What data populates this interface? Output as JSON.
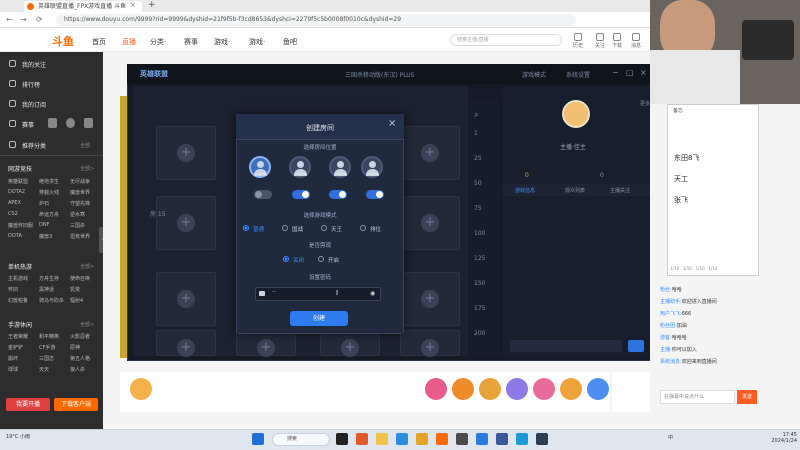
{
  "browser": {
    "tab_title": "英雄联盟直播_FPX游戏直播 斗鱼",
    "tab_close": "×",
    "new_tab": "+",
    "url": "https://www.douyu.com/9999?rid=9999&dyshid=21f9f5b-f3cd8653&dyshci=2279f5c5b0008f0010c&dyshid=29",
    "nav_back": "←",
    "nav_forward": "→",
    "nav_reload": "⟳"
  },
  "site": {
    "logo": "斗鱼",
    "nav": [
      "首页",
      "直播",
      "分类·",
      "赛事",
      "游戏·",
      "游戏·",
      "鱼吧"
    ],
    "search_placeholder": "搜索主播/直播",
    "header_icons": [
      "历史",
      "关注",
      "下载",
      "消息"
    ]
  },
  "sidebar": {
    "top_items": [
      "我的关注",
      "排行榜",
      "我的订阅",
      "赛事"
    ],
    "section1_title": "推荐分类",
    "section1_more": "全部",
    "section2_title": "网游竞技",
    "section2_more": "全部>",
    "section2_grid": [
      "英雄联盟",
      "绝地求生",
      "无尽战争",
      "DOTA2",
      "穿越火线",
      "魔兽世界",
      "APEX",
      "炉石",
      "守望先锋",
      "CS2",
      "命运方舟",
      "逆水寒",
      "魔兽怀旧服",
      "DNF",
      "三国杀",
      "DOTA",
      "魔兽3",
      "坦克世界"
    ],
    "section3_title": "单机热游",
    "section3_more": "全部>",
    "section3_grid": [
      "主机游戏",
      "方舟生存",
      "使命召唤",
      "怀旧",
      "黑神话",
      "饥荒",
      "幻兽帕鲁",
      "骑马与砍杀",
      "辐射4"
    ],
    "section4_title": "手游休闲",
    "section4_more": "全部>",
    "section4_grid": [
      "王者荣耀",
      "和平精英",
      "火影忍者",
      "金铲铲",
      "CF手游",
      "原神",
      "崩坏",
      "三国志",
      "第五人格",
      "球球",
      "天天",
      "狼人杀"
    ],
    "btn_live": "我要开播",
    "btn_download": "下载客户端"
  },
  "client": {
    "app_name": "英雄联盟",
    "room_title": "三国杀移动版(东汉) PLUS",
    "mode_btn": "游戏模式",
    "settings_btn": "系统设置",
    "min": "−",
    "max": "□",
    "close": "×",
    "slot_room_label": "房 15",
    "numbers": [
      "1",
      "25",
      "50",
      "75",
      "100",
      "125",
      "150",
      "175",
      "200"
    ],
    "right_name": "主播·佳主",
    "right_tabs": [
      "游戏信息",
      "观众列表",
      "主播关注"
    ],
    "coin": "0",
    "chip": "0",
    "right_more": "更多>",
    "plus": "+"
  },
  "dialog": {
    "title": "创建房间",
    "close": "×",
    "seat_section": "选择房间位置",
    "seats": [
      "PLAYER",
      "PLAYER",
      "PLAYER",
      "PLAYER"
    ],
    "seat_toggles": [
      false,
      true,
      true,
      true
    ],
    "mode_section": "选择游戏模式",
    "modes": [
      "普通",
      "国战",
      "天王",
      "排位"
    ],
    "mode_selected": 0,
    "audience_section": "是否旁观",
    "audience_options": [
      "关闭",
      "开启"
    ],
    "audience_selected": 0,
    "password_section": "设置密码",
    "password_value": "··",
    "create_btn": "创建"
  },
  "note": {
    "title": "备忘",
    "lines": [
      "东田8飞",
      "天工",
      "张飞"
    ],
    "footer": [
      "1/10",
      "1/10",
      "1/10",
      "1/10"
    ]
  },
  "danmu": [
    {
      "user": "粉丝:",
      "text": "哈哈"
    },
    {
      "user": "主播助手:",
      "text": "欢迎进入直播间"
    },
    {
      "user": "用户飞飞:",
      "text": "666"
    },
    {
      "user": "粉丝团:",
      "text": "加油"
    },
    {
      "user": "游客:",
      "text": "哈哈哈"
    },
    {
      "user": "主播:",
      "text": "你可以加入"
    },
    {
      "user": "系统消息:",
      "text": "欢迎来到直播间"
    }
  ],
  "danmu_input_placeholder": "在弹幕中说点什么",
  "send_btn": "发送",
  "taskbar": {
    "weather": "19°C 小雨",
    "search": "搜索",
    "tray": "中",
    "time": "17:45",
    "date": "2024/1/24"
  },
  "colors": {
    "accent": "#2f7bf0",
    "brand": "#ff5d23",
    "dialog_bg": "#1f2a3d",
    "client_bg": "#141a26"
  }
}
